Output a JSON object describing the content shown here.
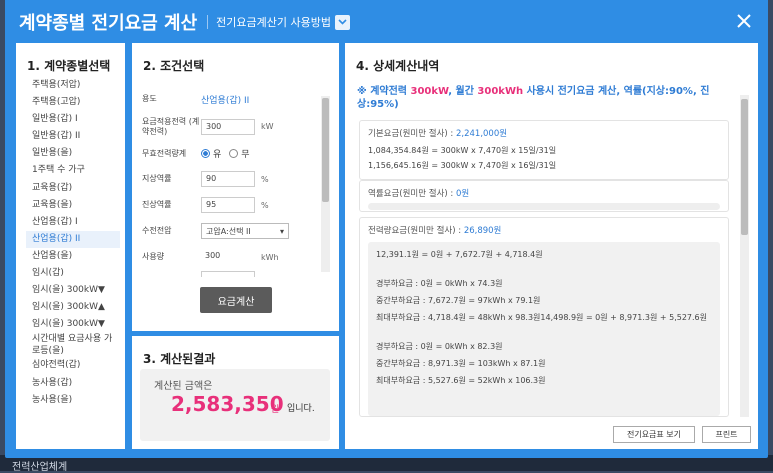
{
  "title": "계약종별 전기요금 계산",
  "subtitle": "전기요금계산기 사용방법",
  "background_footer": "전력산업체계",
  "panel1": {
    "title": "1. 계약종별선택",
    "items": [
      "주택용(저압)",
      "주택용(고압)",
      "일반용(갑) I",
      "일반용(갑) II",
      "일반용(을)",
      "1주택 수 가구",
      "교육용(갑)",
      "교육용(을)",
      "산업용(갑) I",
      "산업용(갑) II",
      "산업용(을)",
      "임시(갑)",
      "임시(을) 300kW▼",
      "임시(을) 300kW▲",
      "임시(을) 300kW▼",
      "시간대별 요금사용 가로등(을)",
      "심야전력(갑)",
      "농사용(갑)",
      "농사용(을)"
    ],
    "active_index": 9
  },
  "panel2": {
    "title": "2. 조건선택",
    "usage_label": "용도",
    "usage_value": "산업용(갑) II",
    "power_label": "요금적용전력 (계약전력)",
    "power_value": "300",
    "power_unit": "kW",
    "reactive_label": "무효전력량계",
    "radio_yes": "유",
    "radio_no": "무",
    "lag_label": "지상역률",
    "lag_value": "90",
    "lag_unit": "%",
    "lead_label": "진상역률",
    "lead_value": "95",
    "lead_unit": "%",
    "voltage_label": "수전전압",
    "voltage_value": "고압A:선택 II",
    "usage_amt_label": "사용량",
    "usage_amt_value": "300",
    "usage_amt_unit": "kWh",
    "calc_button": "요금계산"
  },
  "panel3": {
    "title": "3. 계산된결과",
    "label": "계산된 금액은",
    "amount": "2,583,350",
    "unit": "원",
    "tail": "입니다."
  },
  "panel4": {
    "title": "4. 상세계산내역",
    "summary_prefix": "※ 계약전력 ",
    "summary_kw": "300kW",
    "summary_mid": ", 월간 ",
    "summary_kwh": "300kWh",
    "summary_rest": " 사용시 전기요금 계산, 역률(지상:90%, 진상:95%)",
    "base_head": "기본요금(원미만 절사) : ",
    "base_value": "2,241,000원",
    "base_line1": "1,084,354.84원 = 300kW x 7,470원 x 15일/31일",
    "base_line2": "1,156,645.16원 = 300kW x 7,470원 x 16일/31일",
    "pf_head": "역률요금(원미만 절사) : ",
    "pf_value": "0원",
    "energy_head": "전력량요금(원미만 절사) : ",
    "energy_value": "26,890원",
    "inner_lines": [
      "12,391.1원 = 0원 + 7,672.7원 + 4,718.4원",
      "",
      "경부하요금 : 0원 = 0kWh x 74.3원",
      "중간부하요금 : 7,672.7원 = 97kWh x 79.1원",
      "최대부하요금 : 4,718.4원 = 48kWh x 98.3원14,498.9원 = 0원 + 8,971.3원 + 5,527.6원",
      "",
      "경부하요금 : 0원 = 0kWh x 82.3원",
      "중간부하요금 : 8,971.3원 = 103kWh x 87.1원",
      "최대부하요금 : 5,527.6원 = 52kWh x 106.3원"
    ],
    "table_button": "전기요금표 보기",
    "print_button": "프린트"
  }
}
